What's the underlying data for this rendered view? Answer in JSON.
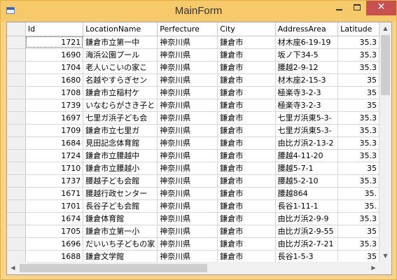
{
  "window": {
    "title": "MainForm",
    "close_glyph": "✕",
    "accent_color": "#f6c96b",
    "close_color": "#c75050"
  },
  "grid": {
    "columns": [
      "Id",
      "LocationName",
      "Perfecture",
      "City",
      "AddressArea",
      "Latitude"
    ],
    "rows": [
      [
        "1721",
        "鎌倉市立第一中",
        "神奈川県",
        "鎌倉市",
        "材木座6-19-19",
        "35.3"
      ],
      [
        "1690",
        "海浜公園プール",
        "神奈川県",
        "鎌倉市",
        "坂ノ下34-5",
        "35.3"
      ],
      [
        "1704",
        "老人いこいの家こ",
        "神奈川県",
        "鎌倉市",
        "腰越2-9-12",
        "35.3"
      ],
      [
        "1680",
        "名越やすらぎセン",
        "神奈川県",
        "鎌倉市",
        "材木座2-15-3",
        "35"
      ],
      [
        "1708",
        "鎌倉市立稲村ケ",
        "神奈川県",
        "鎌倉市",
        "極楽寺3-2-3",
        "35"
      ],
      [
        "1739",
        "いなむらがさき子と",
        "神奈川県",
        "鎌倉市",
        "極楽寺3-2-3",
        "35"
      ],
      [
        "1697",
        "七里ガ浜子ども会",
        "神奈川県",
        "鎌倉市",
        "七里ガ浜東5-3-",
        "35.3"
      ],
      [
        "1709",
        "鎌倉市立七里ガ",
        "神奈川県",
        "鎌倉市",
        "七里ガ浜東5-3-",
        "35.3"
      ],
      [
        "1684",
        "見田記念体育館",
        "神奈川県",
        "鎌倉市",
        "由比ガ浜2-13-2",
        "35.3"
      ],
      [
        "1724",
        "鎌倉市立腰越中",
        "神奈川県",
        "鎌倉市",
        "腰越4-11-20",
        "35.3"
      ],
      [
        "1710",
        "鎌倉市立腰越小",
        "神奈川県",
        "鎌倉市",
        "腰越5-7-1",
        "35"
      ],
      [
        "1737",
        "腰越子ども会館",
        "神奈川県",
        "鎌倉市",
        "腰越5-2-10",
        "35.3"
      ],
      [
        "1671",
        "腰越行政センター",
        "神奈川県",
        "鎌倉市",
        "腰越864",
        "35."
      ],
      [
        "1701",
        "長谷子ども会館",
        "神奈川県",
        "鎌倉市",
        "長谷1-11-1",
        "35."
      ],
      [
        "1674",
        "鎌倉体育館",
        "神奈川県",
        "鎌倉市",
        "由比ガ浜2-9-9",
        "35.3"
      ],
      [
        "1705",
        "鎌倉市立第一小",
        "神奈川県",
        "鎌倉市",
        "由比ガ浜2-9-55",
        "35"
      ],
      [
        "1696",
        "だいいち子どもの家",
        "神奈川県",
        "鎌倉市",
        "由比ガ浜2-7-21",
        "35.3"
      ],
      [
        "1688",
        "鎌倉文学館",
        "神奈川県",
        "鎌倉市",
        "長谷1-5-3",
        "35"
      ]
    ]
  },
  "scrollbars": {
    "up_arrow": "▲",
    "down_arrow": "▼",
    "left_arrow": "◀",
    "right_arrow": "▶"
  }
}
